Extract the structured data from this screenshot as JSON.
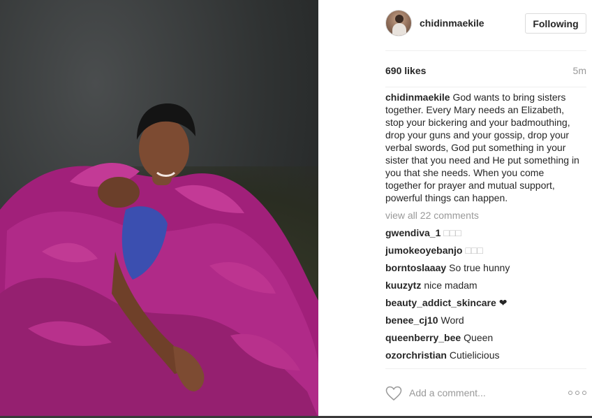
{
  "post": {
    "username": "chidinmaekile",
    "follow_label": "Following",
    "likes": "690 likes",
    "time": "5m",
    "caption_user": "chidinmaekile",
    "caption_text": "God wants to bring sisters together. Every Mary needs an Elizabeth, stop your bickering and your badmouthing, drop your guns and your gossip, drop your verbal swords, God put something in your sister that you need and He put something in you that she needs. When you come together for prayer and mutual support, powerful things can happen.",
    "view_all": "view all 22 comments",
    "comments": [
      {
        "user": "gwendiva_1",
        "text": "□□□"
      },
      {
        "user": "jumokeoyebanjo",
        "text": "□□□"
      },
      {
        "user": "borntoslaaay",
        "text": "So true hunny"
      },
      {
        "user": "kuuzytz",
        "text": "nice madam"
      },
      {
        "user": "beauty_addict_skincare",
        "text": "❤"
      },
      {
        "user": "benee_cj10",
        "text": "Word"
      },
      {
        "user": "queenberry_bee",
        "text": "Queen"
      },
      {
        "user": "ozorchristian",
        "text": "Cutielicious"
      }
    ],
    "comment_placeholder": "Add a comment..."
  },
  "icons": {
    "heart": "heart-outline-icon",
    "more": "more-options-icon"
  },
  "colors": {
    "dress": "#a8237f",
    "muted_text": "#999999",
    "divider": "#efefef"
  }
}
